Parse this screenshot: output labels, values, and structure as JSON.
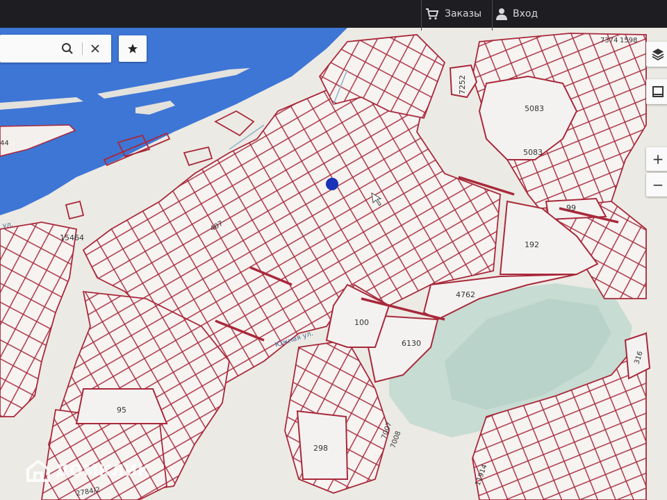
{
  "header": {
    "orders_label": "Заказы",
    "login_label": "Вход"
  },
  "search": {
    "search_icon": "search-icon",
    "clear_icon": "close-icon",
    "favorite_icon": "star-icon"
  },
  "map_controls": {
    "layers_icon": "layers-icon",
    "frame_icon": "frame-icon",
    "zoom_in_label": "+",
    "zoom_out_label": "−"
  },
  "brand": {
    "name": "ДОМКЛИК",
    "logo_icon": "house-logo-icon"
  },
  "colors": {
    "parcel_border": "#a8283a",
    "water": "#3e76d6",
    "land": "#eceae4",
    "marker": "#1a33b8",
    "header_bg": "#1e1e22"
  },
  "map": {
    "parcel_numbers": [
      "5083",
      "5083",
      "7252",
      "99",
      "192",
      "4762",
      "6130",
      "100",
      "407",
      "15464",
      "95",
      "298",
      "316",
      "11914",
      "7007",
      "7008",
      "44",
      "2784/2",
      "7374",
      "1598"
    ],
    "street_labels": [
      "Южная ул.",
      "ул."
    ]
  }
}
